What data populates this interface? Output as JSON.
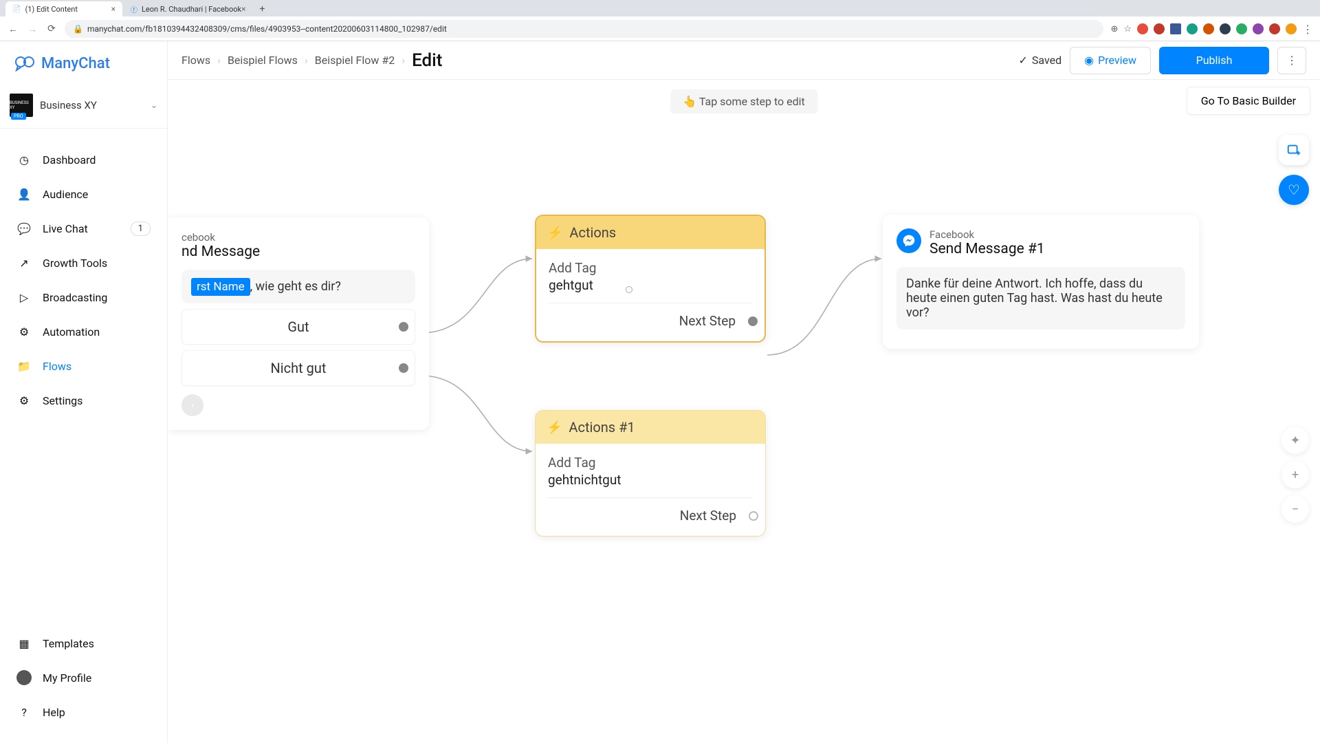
{
  "browser": {
    "tabs": [
      {
        "title": "(1) Edit Content",
        "active": true
      },
      {
        "title": "Leon R. Chaudhari | Facebook",
        "active": false
      }
    ],
    "url": "manychat.com/fb181039443240830​9/cms/files/4903953--content20200603114800_102987/edit"
  },
  "app": {
    "brand": "ManyChat",
    "account": "Business XY",
    "account_badge": "BUSINESS XY",
    "pro": "PRO"
  },
  "sidebar": {
    "items": [
      {
        "label": "Dashboard"
      },
      {
        "label": "Audience"
      },
      {
        "label": "Live Chat",
        "badge": "1"
      },
      {
        "label": "Growth Tools"
      },
      {
        "label": "Broadcasting"
      },
      {
        "label": "Automation"
      },
      {
        "label": "Flows",
        "active": true
      },
      {
        "label": "Settings"
      }
    ],
    "bottom": [
      {
        "label": "Templates"
      },
      {
        "label": "My Profile"
      },
      {
        "label": "Help"
      }
    ]
  },
  "topbar": {
    "breadcrumb": [
      "Flows",
      "Beispiel Flows",
      "Beispiel Flow #2"
    ],
    "current": "Edit",
    "saved": "Saved",
    "preview": "Preview",
    "publish": "Publish"
  },
  "canvas": {
    "tip": "👆 Tap some step to edit",
    "goto_basic": "Go To Basic Builder"
  },
  "nodes": {
    "send1": {
      "platform": "cebook",
      "title": "nd Message",
      "var_pill": "rst Name",
      "msg_suffix": ", wie geht es dir?",
      "choice1": "Gut",
      "choice2": "Nicht gut"
    },
    "actions1": {
      "title": "Actions",
      "label": "Add Tag",
      "value": "gehtgut",
      "next": "Next Step"
    },
    "actions2": {
      "title": "Actions #1",
      "label": "Add Tag",
      "value": "gehtnichtgut",
      "next": "Next Step"
    },
    "send2": {
      "platform": "Facebook",
      "title": "Send Message #1",
      "message": "Danke für deine Antwort. Ich hoffe, dass du heute einen guten Tag hast. Was hast du heute vor?"
    }
  }
}
